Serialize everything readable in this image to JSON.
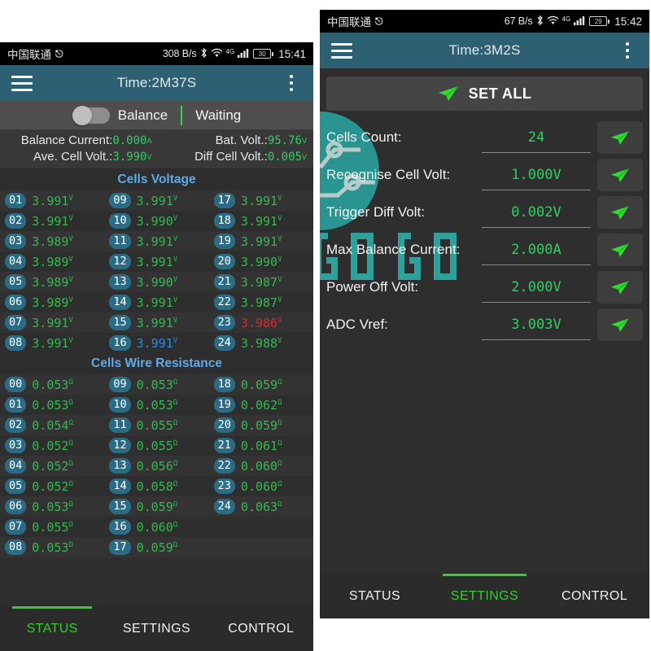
{
  "left_screen": {
    "statusbar": {
      "carrier": "中国联通",
      "usb_icon": "usb-icon",
      "data_rate": "308 B/s",
      "bluetooth_icon": "bluetooth-icon",
      "wifi_icon": "wifi-icon",
      "network_type": "4G",
      "signal_icon": "signal-bars-icon",
      "battery_level": "30",
      "time": "15:41"
    },
    "appbar": {
      "menu_icon": "hamburger-menu-icon",
      "title": "Time:2M37S",
      "overflow_icon": "kebab-menu-icon"
    },
    "balance_bar": {
      "toggle_state": "off",
      "toggle_label": "Balance",
      "status_text": "Waiting"
    },
    "info": {
      "balance_current_label": "Balance Current:",
      "balance_current_value": "0.000",
      "balance_current_unit": "A",
      "bat_volt_label": "Bat. Volt.:",
      "bat_volt_value": "95.76",
      "bat_volt_unit": "V",
      "ave_cell_volt_label": "Ave. Cell Volt.:",
      "ave_cell_volt_value": "3.990",
      "ave_cell_volt_unit": "V",
      "diff_cell_volt_label": "Diff Cell Volt.:",
      "diff_cell_volt_value": "0.005",
      "diff_cell_volt_unit": "V"
    },
    "cells_voltage": {
      "title": "Cells Voltage",
      "unit": "V",
      "cells": [
        {
          "idx": "01",
          "value": "3.991",
          "state": "normal"
        },
        {
          "idx": "02",
          "value": "3.991",
          "state": "normal"
        },
        {
          "idx": "03",
          "value": "3.989",
          "state": "normal"
        },
        {
          "idx": "04",
          "value": "3.989",
          "state": "normal"
        },
        {
          "idx": "05",
          "value": "3.989",
          "state": "normal"
        },
        {
          "idx": "06",
          "value": "3.989",
          "state": "normal"
        },
        {
          "idx": "07",
          "value": "3.991",
          "state": "normal"
        },
        {
          "idx": "08",
          "value": "3.991",
          "state": "normal"
        },
        {
          "idx": "09",
          "value": "3.991",
          "state": "normal"
        },
        {
          "idx": "10",
          "value": "3.990",
          "state": "normal"
        },
        {
          "idx": "11",
          "value": "3.991",
          "state": "normal"
        },
        {
          "idx": "12",
          "value": "3.991",
          "state": "normal"
        },
        {
          "idx": "13",
          "value": "3.990",
          "state": "normal"
        },
        {
          "idx": "14",
          "value": "3.991",
          "state": "normal"
        },
        {
          "idx": "15",
          "value": "3.991",
          "state": "normal"
        },
        {
          "idx": "16",
          "value": "3.991",
          "state": "high"
        },
        {
          "idx": "17",
          "value": "3.991",
          "state": "normal"
        },
        {
          "idx": "18",
          "value": "3.991",
          "state": "normal"
        },
        {
          "idx": "19",
          "value": "3.991",
          "state": "normal"
        },
        {
          "idx": "20",
          "value": "3.990",
          "state": "normal"
        },
        {
          "idx": "21",
          "value": "3.987",
          "state": "normal"
        },
        {
          "idx": "22",
          "value": "3.987",
          "state": "normal"
        },
        {
          "idx": "23",
          "value": "3.986",
          "state": "low"
        },
        {
          "idx": "24",
          "value": "3.988",
          "state": "normal"
        }
      ]
    },
    "cells_wire_resistance": {
      "title": "Cells Wire Resistance",
      "unit": "Ω",
      "cells": [
        {
          "idx": "00",
          "value": "0.053"
        },
        {
          "idx": "01",
          "value": "0.053"
        },
        {
          "idx": "02",
          "value": "0.054"
        },
        {
          "idx": "03",
          "value": "0.052"
        },
        {
          "idx": "04",
          "value": "0.052"
        },
        {
          "idx": "05",
          "value": "0.052"
        },
        {
          "idx": "06",
          "value": "0.053"
        },
        {
          "idx": "07",
          "value": "0.055"
        },
        {
          "idx": "08",
          "value": "0.053"
        },
        {
          "idx": "09",
          "value": "0.053"
        },
        {
          "idx": "10",
          "value": "0.053"
        },
        {
          "idx": "11",
          "value": "0.055"
        },
        {
          "idx": "12",
          "value": "0.055"
        },
        {
          "idx": "13",
          "value": "0.056"
        },
        {
          "idx": "14",
          "value": "0.058"
        },
        {
          "idx": "15",
          "value": "0.059"
        },
        {
          "idx": "16",
          "value": "0.060"
        },
        {
          "idx": "17",
          "value": "0.059"
        },
        {
          "idx": "18",
          "value": "0.059"
        },
        {
          "idx": "19",
          "value": "0.062"
        },
        {
          "idx": "20",
          "value": "0.059"
        },
        {
          "idx": "21",
          "value": "0.061"
        },
        {
          "idx": "22",
          "value": "0.060"
        },
        {
          "idx": "23",
          "value": "0.060"
        },
        {
          "idx": "24",
          "value": "0.063"
        },
        {
          "idx": "",
          "value": ""
        }
      ]
    },
    "tabs": [
      {
        "label": "STATUS",
        "active": true
      },
      {
        "label": "SETTINGS",
        "active": false
      },
      {
        "label": "CONTROL",
        "active": false
      }
    ]
  },
  "right_screen": {
    "statusbar": {
      "carrier": "中国联通",
      "usb_icon": "usb-icon",
      "data_rate": "67 B/s",
      "bluetooth_icon": "bluetooth-icon",
      "wifi_icon": "wifi-icon",
      "network_type": "4G",
      "signal_icon": "signal-bars-icon",
      "battery_level": "29",
      "time": "15:42"
    },
    "appbar": {
      "menu_icon": "hamburger-menu-icon",
      "title": "Time:3M2S",
      "overflow_icon": "kebab-menu-icon"
    },
    "set_all_button": {
      "icon": "send-plane-icon",
      "label": "SET ALL"
    },
    "settings": [
      {
        "label": "Cells Count:",
        "value": "24",
        "send_icon": "send-plane-icon"
      },
      {
        "label": "Recognise Cell Volt:",
        "value": "1.000V",
        "send_icon": "send-plane-icon"
      },
      {
        "label": "Trigger Diff Volt:",
        "value": "0.002V",
        "send_icon": "send-plane-icon"
      },
      {
        "label": "Max Balance Current:",
        "value": "2.000A",
        "send_icon": "send-plane-icon"
      },
      {
        "label": "Power Off Volt:",
        "value": "2.000V",
        "send_icon": "send-plane-icon"
      },
      {
        "label": "ADC Vref:",
        "value": "3.003V",
        "send_icon": "send-plane-icon"
      }
    ],
    "tabs": [
      {
        "label": "STATUS",
        "active": false
      },
      {
        "label": "SETTINGS",
        "active": true
      },
      {
        "label": "CONTROL",
        "active": false
      }
    ]
  },
  "watermark": {
    "text": "GOGO",
    "circle_color": "#2a9a96",
    "left_text_color": "#c0203a",
    "right_text_color": "#2fa8a2"
  },
  "colors": {
    "appbar": "#2d6073",
    "accent_green": "#2fcf62",
    "tab_active": "#2fcf2f",
    "section_title": "#5ea9e8",
    "cell_low": "#e8242e",
    "cell_high": "#2f86e0",
    "index_badge": "#2c6b84"
  }
}
